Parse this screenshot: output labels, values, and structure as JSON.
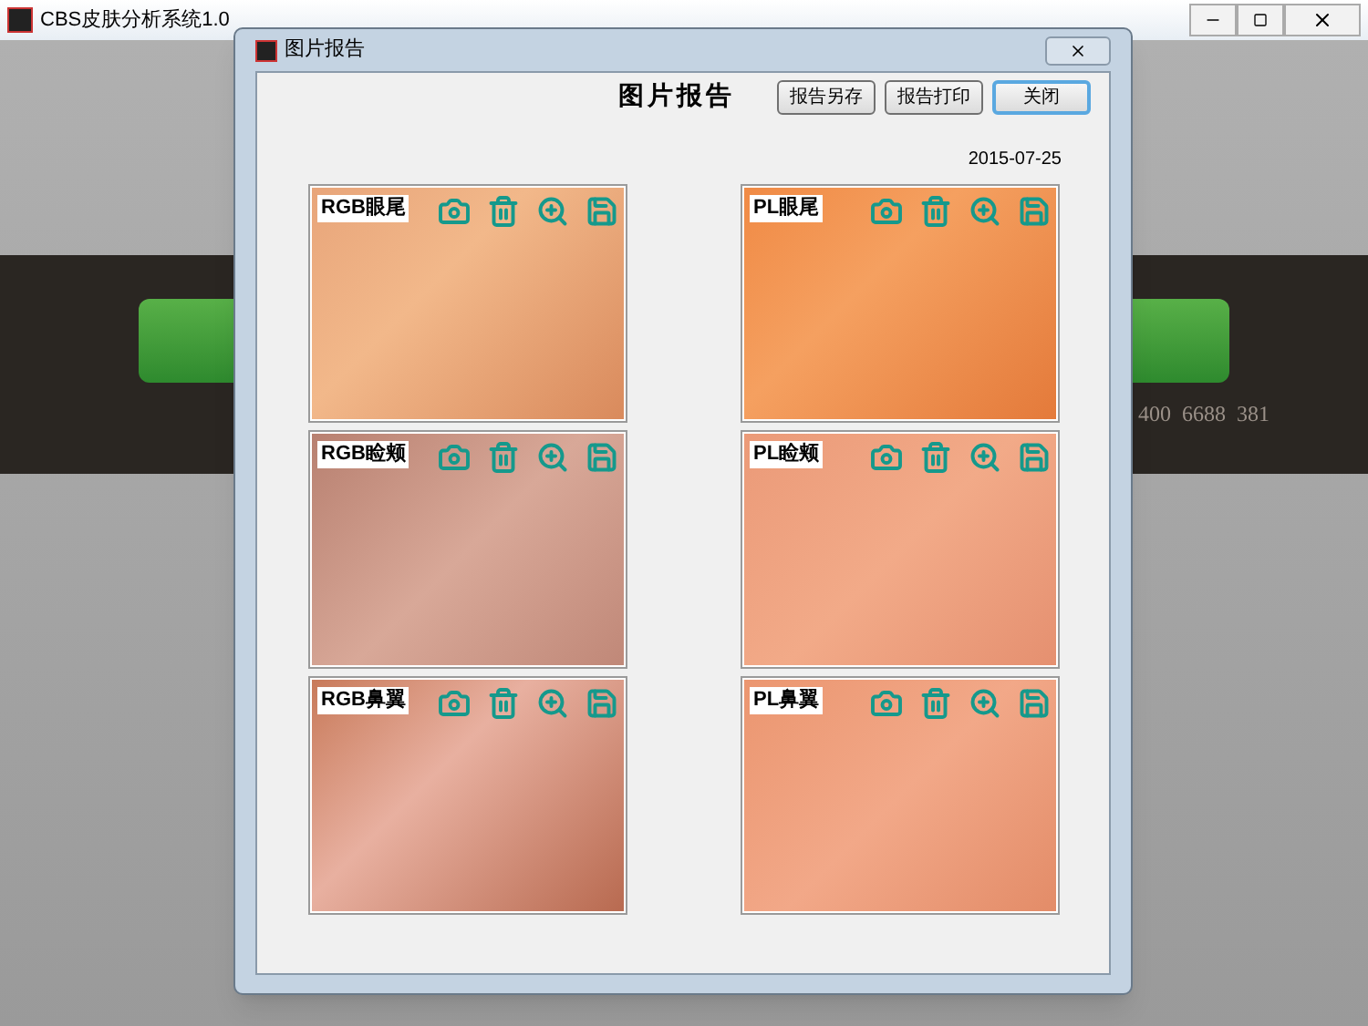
{
  "app_window": {
    "title": "CBS皮肤分析系统1.0"
  },
  "background": {
    "phone_text": "400  6688  381"
  },
  "dialog": {
    "title": "图片报告",
    "heading": "图片报告",
    "buttons": [
      {
        "label": "报告另存",
        "focused": false
      },
      {
        "label": "报告打印",
        "focused": false
      },
      {
        "label": "关闭",
        "focused": true
      }
    ],
    "date": "2015-07-25",
    "images": [
      {
        "label": "RGB眼尾"
      },
      {
        "label": "PL眼尾"
      },
      {
        "label": "RGB睑颊"
      },
      {
        "label": "PL睑颊"
      },
      {
        "label": "RGB鼻翼"
      },
      {
        "label": "PL鼻翼"
      }
    ]
  }
}
